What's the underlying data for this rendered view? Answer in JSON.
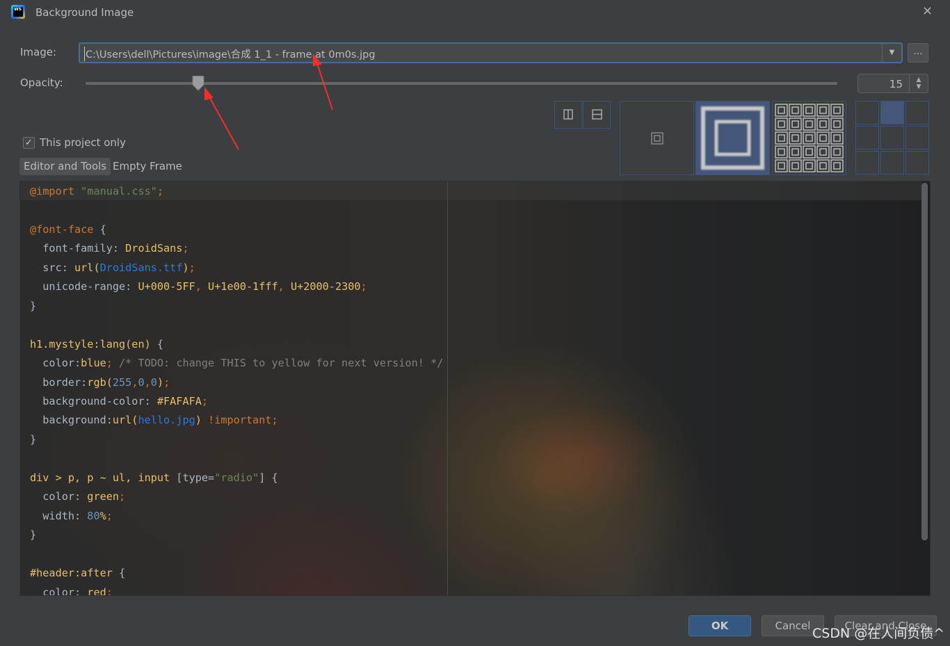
{
  "window": {
    "title": "Background Image",
    "close_icon": "close-icon"
  },
  "image": {
    "label": "Image:",
    "value": "C:\\Users\\dell\\Pictures\\image\\合成 1_1 - frame at 0m0s.jpg",
    "browse_label": "..."
  },
  "opacity": {
    "label": "Opacity:",
    "value": 15,
    "display": "15",
    "min": 0,
    "max": 100
  },
  "this_project_only": {
    "label": "This project only",
    "checked": true
  },
  "tabs": [
    {
      "label": "Editor and Tools",
      "selected": true
    },
    {
      "label": "Empty Frame",
      "selected": false
    }
  ],
  "fill_modes": [
    "plain",
    "scale",
    "tile"
  ],
  "fill_selected": "scale",
  "anchor": {
    "selected": "top-center"
  },
  "colors": {
    "accent": "#365880",
    "selection": "#466d94",
    "annotation": "#ff2a2a"
  },
  "code": {
    "lines": [
      [
        [
          "@import",
          "kw"
        ],
        [
          " ",
          "p"
        ],
        [
          "\"manual.css\"",
          "str"
        ],
        [
          ";",
          "kw"
        ]
      ],
      [],
      [
        [
          "@font-face",
          "kw"
        ],
        [
          " {",
          "p"
        ]
      ],
      [
        [
          "  font-family: ",
          "p"
        ],
        [
          "DroidSans",
          "val"
        ],
        [
          ";",
          "kw"
        ]
      ],
      [
        [
          "  src: ",
          "p"
        ],
        [
          "url(",
          "val"
        ],
        [
          "DroidSans.ttf",
          "url"
        ],
        [
          ")",
          "val"
        ],
        [
          ";",
          "kw"
        ]
      ],
      [
        [
          "  unicode-range: ",
          "p"
        ],
        [
          "U+000-5FF",
          "val"
        ],
        [
          ", ",
          "kw"
        ],
        [
          "U+1e00-1fff",
          "val"
        ],
        [
          ", ",
          "kw"
        ],
        [
          "U+2000-2300",
          "val"
        ],
        [
          ";",
          "kw"
        ]
      ],
      [
        [
          "}",
          "p"
        ]
      ],
      [],
      [
        [
          "h1.mystyle:lang(en)",
          "sel"
        ],
        [
          " {",
          "p"
        ]
      ],
      [
        [
          "  color:",
          "p"
        ],
        [
          "blue",
          "val"
        ],
        [
          "; ",
          "kw"
        ],
        [
          "/* TODO: change THIS to yellow for next version! */",
          "com"
        ]
      ],
      [
        [
          "  border:",
          "p"
        ],
        [
          "rgb(",
          "val"
        ],
        [
          "255",
          "num"
        ],
        [
          ",",
          "kw"
        ],
        [
          "0",
          "num"
        ],
        [
          ",",
          "kw"
        ],
        [
          "0",
          "num"
        ],
        [
          ")",
          "val"
        ],
        [
          ";",
          "kw"
        ]
      ],
      [
        [
          "  background-color: ",
          "p"
        ],
        [
          "#FAFAFA",
          "val"
        ],
        [
          ";",
          "kw"
        ]
      ],
      [
        [
          "  background:",
          "p"
        ],
        [
          "url(",
          "val"
        ],
        [
          "hello.jpg",
          "url"
        ],
        [
          ") ",
          "val"
        ],
        [
          "!important",
          "kw"
        ],
        [
          ";",
          "kw"
        ]
      ],
      [
        [
          "}",
          "p"
        ]
      ],
      [],
      [
        [
          "div > p, p ~ ul, input ",
          "sel"
        ],
        [
          "[type=",
          "p"
        ],
        [
          "\"radio\"",
          "str"
        ],
        [
          "] {",
          "p"
        ]
      ],
      [
        [
          "  color: ",
          "p"
        ],
        [
          "green",
          "val"
        ],
        [
          ";",
          "kw"
        ]
      ],
      [
        [
          "  width: ",
          "p"
        ],
        [
          "80",
          "num"
        ],
        [
          "%",
          "val"
        ],
        [
          ";",
          "kw"
        ]
      ],
      [
        [
          "}",
          "p"
        ]
      ],
      [],
      [
        [
          "#header:after",
          "sel"
        ],
        [
          " {",
          "p"
        ]
      ],
      [
        [
          "  color: ",
          "p"
        ],
        [
          "red",
          "val"
        ],
        [
          ";",
          "kw"
        ]
      ]
    ]
  },
  "buttons": {
    "ok": "OK",
    "cancel": "Cancel",
    "clear": "Clear and Close"
  },
  "watermark": "CSDN @在人间负债^"
}
